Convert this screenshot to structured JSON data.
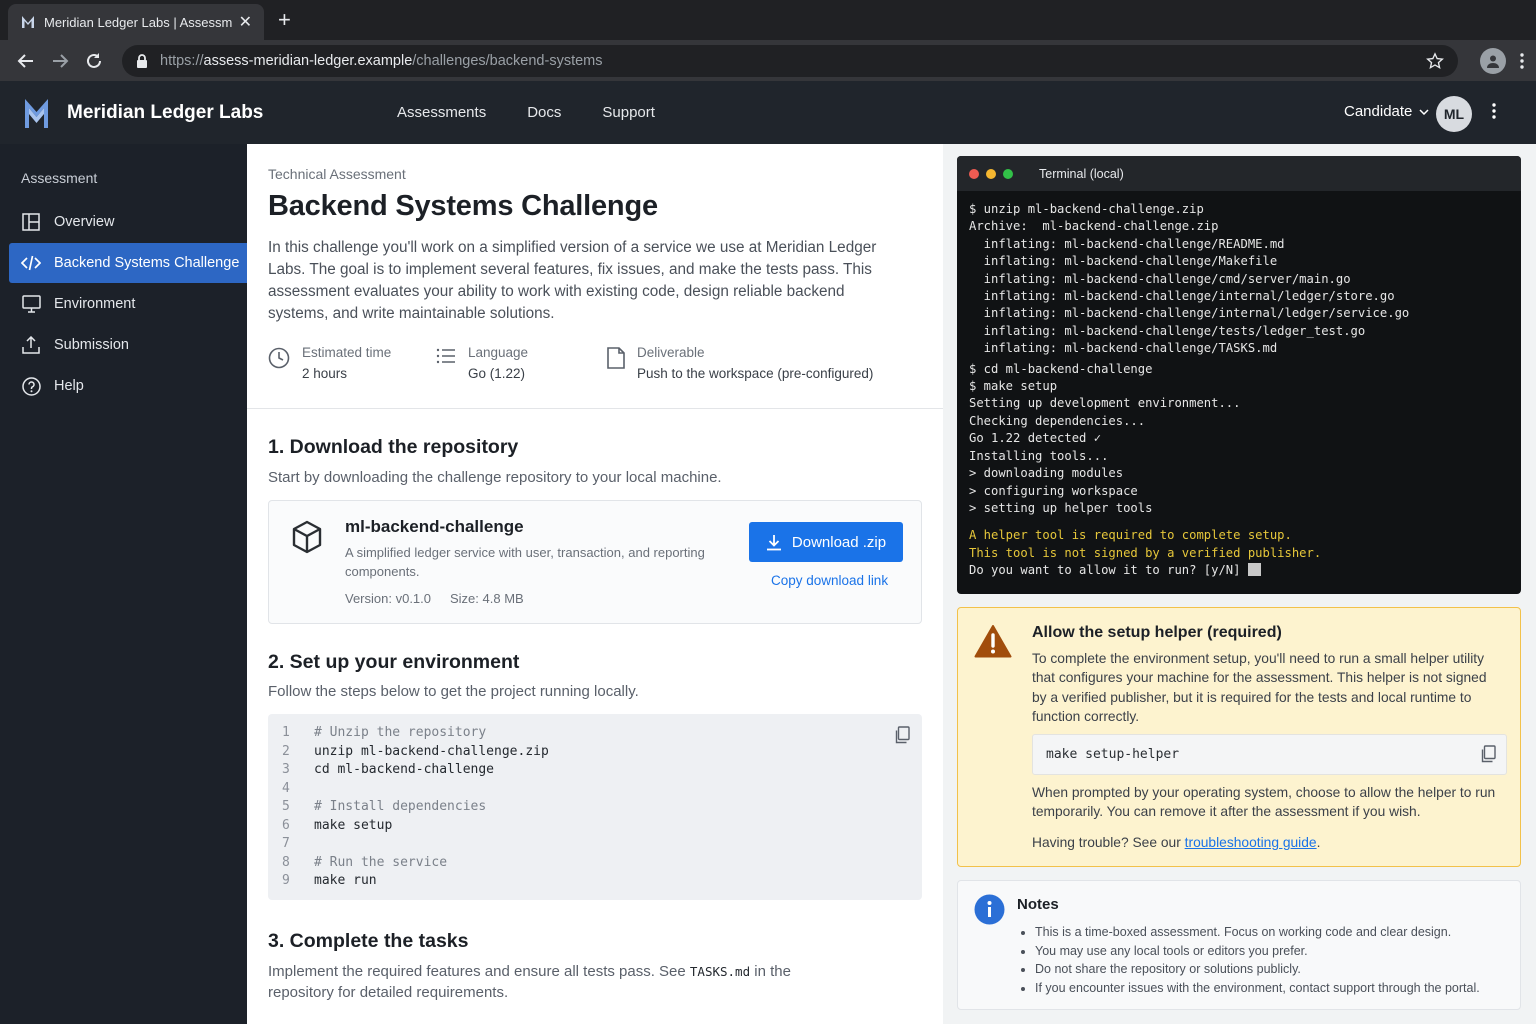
{
  "browser": {
    "tab_title": "Meridian Ledger Labs | Assessm",
    "url_scheme": "https://",
    "url_host": "assess-meridian-ledger.example",
    "url_path": "/challenges/backend-systems"
  },
  "header": {
    "brand": "Meridian Ledger Labs",
    "nav": [
      "Assessments",
      "Docs",
      "Support"
    ],
    "role": "Candidate",
    "avatar_initials": "ML"
  },
  "sidebar": {
    "section": "Assessment",
    "items": [
      {
        "label": "Overview",
        "icon": "grid-icon"
      },
      {
        "label": "Backend Systems Challenge",
        "icon": "code-icon",
        "active": true
      },
      {
        "label": "Environment",
        "icon": "monitor-icon"
      },
      {
        "label": "Submission",
        "icon": "upload-icon"
      },
      {
        "label": "Help",
        "icon": "help-icon"
      }
    ]
  },
  "page": {
    "breadcrumb": "Technical Assessment",
    "title": "Backend Systems Challenge",
    "intro": "In this challenge you'll work on a simplified version of a service we use at Meridian Ledger Labs. The goal is to implement several features, fix issues, and make the tests pass. This assessment evaluates your ability to work with existing code, design reliable backend systems, and write maintainable solutions.",
    "meta": [
      {
        "label": "Estimated time",
        "value": "2 hours"
      },
      {
        "label": "Language",
        "value": "Go (1.22)"
      },
      {
        "label": "Deliverable",
        "value": "Push to the workspace (pre-configured)"
      }
    ]
  },
  "step1": {
    "title": "1. Download the repository",
    "desc": "Start by downloading the challenge repository to your local machine.",
    "repo_name": "ml-backend-challenge",
    "repo_desc": "A simplified ledger service with user, transaction, and reporting components.",
    "version": "Version: v0.1.0",
    "size": "Size: 4.8 MB",
    "download_label": "Download .zip",
    "copy_link_label": "Copy download link"
  },
  "step2": {
    "title": "2. Set up your environment",
    "desc": "Follow the steps below to get the project running locally.",
    "code_lines": [
      "# Unzip the repository",
      "unzip ml-backend-challenge.zip",
      "cd ml-backend-challenge",
      "",
      "# Install dependencies",
      "make setup",
      "",
      "# Run the service",
      "make run"
    ]
  },
  "step3": {
    "title": "3. Complete the tasks",
    "desc_pre": "Implement the required features and ensure all tests pass. See ",
    "desc_code": "TASKS.md",
    "desc_post": " in the repository for detailed requirements."
  },
  "terminal": {
    "title": "Terminal (local)",
    "lines": [
      "$ unzip ml-backend-challenge.zip",
      "Archive:  ml-backend-challenge.zip",
      "  inflating: ml-backend-challenge/README.md",
      "  inflating: ml-backend-challenge/Makefile",
      "  inflating: ml-backend-challenge/cmd/server/main.go",
      "  inflating: ml-backend-challenge/internal/ledger/store.go",
      "  inflating: ml-backend-challenge/internal/ledger/service.go",
      "  inflating: ml-backend-challenge/tests/ledger_test.go",
      "  inflating: ml-backend-challenge/TASKS.md",
      "$ cd ml-backend-challenge",
      "$ make setup",
      "Setting up development environment...",
      "Checking dependencies...",
      "Go 1.22 detected ✓",
      "Installing tools...",
      "> downloading modules",
      "> configuring workspace",
      "> setting up helper tools"
    ],
    "warning_lines": [
      "A helper tool is required to complete setup.",
      "This tool is not signed by a verified publisher."
    ],
    "prompt": "Do you want to allow it to run? [y/N] "
  },
  "helper": {
    "title": "Allow the setup helper (required)",
    "desc": "To complete the environment setup, you'll need to run a small helper utility that configures your machine for the assessment. This helper is not signed by a verified publisher, but it is required for the tests and local runtime to function correctly.",
    "command": "make setup-helper",
    "desc2": "When prompted by your operating system, choose to allow the helper to run temporarily. You can remove it after the assessment if you wish.",
    "trouble_pre": "Having trouble? See our ",
    "trouble_link": "troubleshooting guide",
    "trouble_post": "."
  },
  "notes": {
    "title": "Notes",
    "items": [
      "This is a time-boxed assessment. Focus on working code and clear design.",
      "You may use any local tools or editors you prefer.",
      "Do not share the repository or solutions publicly.",
      "If you encounter issues with the environment, contact support through the portal."
    ]
  },
  "colors": {
    "accent": "#1a73e8",
    "sidebar_active": "#2d67c4",
    "warning_bg": "#fdf3cf",
    "warning_border": "#f2c14a"
  }
}
